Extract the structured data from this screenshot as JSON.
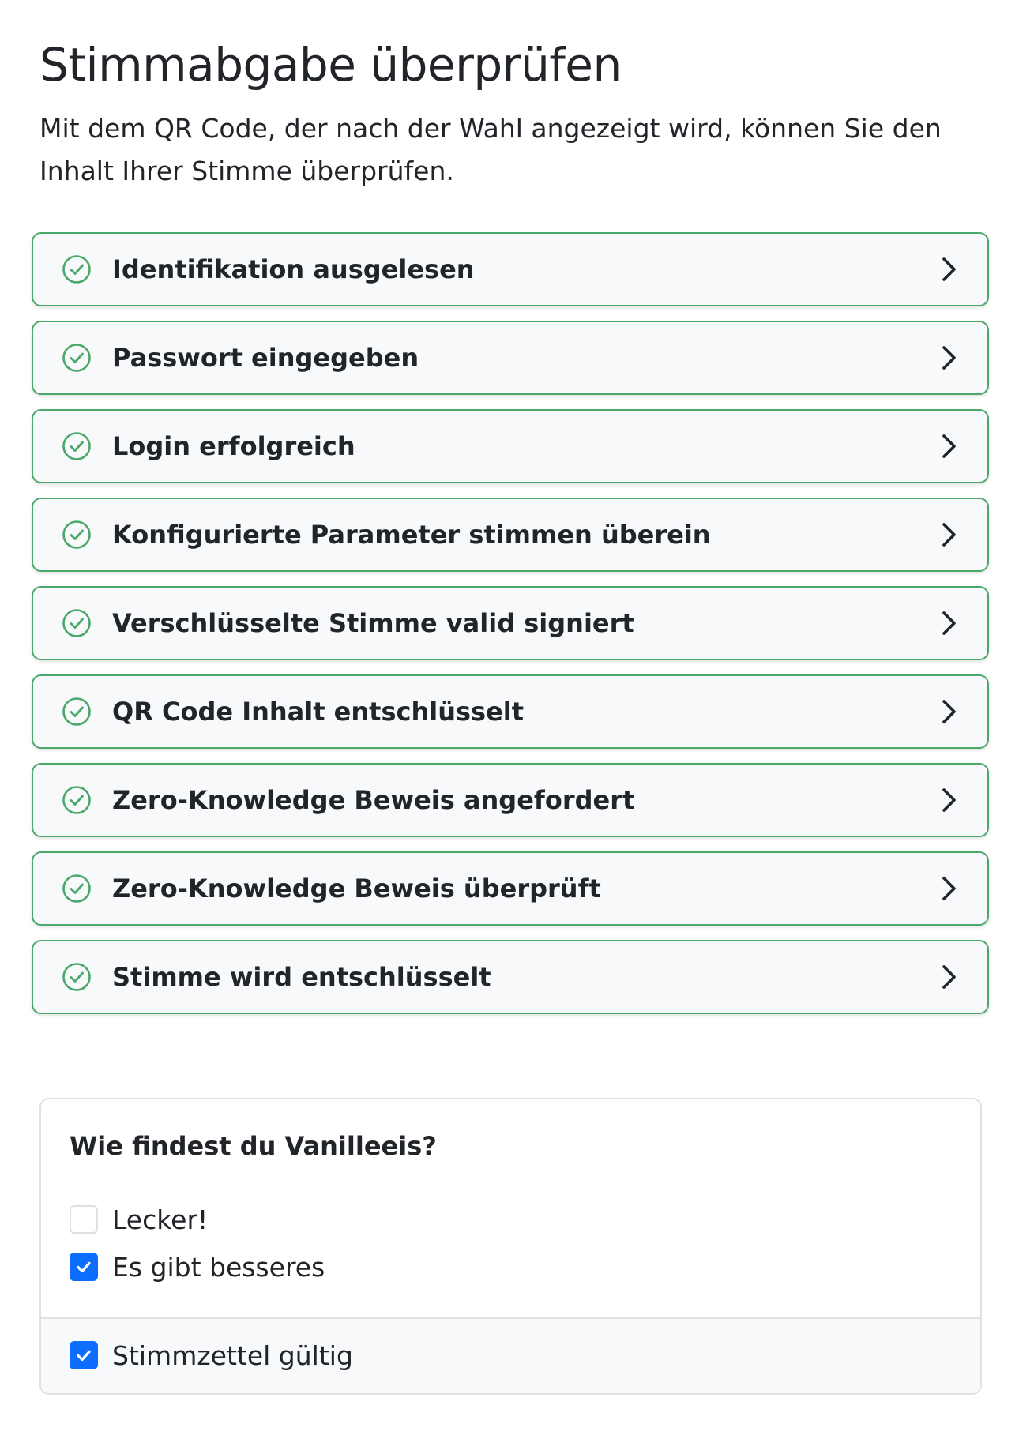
{
  "header": {
    "title": "Stimmabgabe überprüfen",
    "intro": "Mit dem QR Code, der nach der Wahl angezeigt wird, können Sie den Inhalt Ihrer Stimme überprüfen."
  },
  "steps": [
    {
      "label": "Identifikation ausgelesen",
      "status": "success"
    },
    {
      "label": "Passwort eingegeben",
      "status": "success"
    },
    {
      "label": "Login erfolgreich",
      "status": "success"
    },
    {
      "label": "Konfigurierte Parameter stimmen überein",
      "status": "success"
    },
    {
      "label": "Verschlüsselte Stimme valid signiert",
      "status": "success"
    },
    {
      "label": "QR Code Inhalt entschlüsselt",
      "status": "success"
    },
    {
      "label": "Zero-Knowledge Beweis angefordert",
      "status": "success"
    },
    {
      "label": "Zero-Knowledge Beweis überprüft",
      "status": "success"
    },
    {
      "label": "Stimme wird entschlüsselt",
      "status": "success"
    }
  ],
  "ballot": {
    "question": "Wie findest du Vanilleeis?",
    "options": [
      {
        "label": "Lecker!",
        "checked": false
      },
      {
        "label": "Es gibt besseres",
        "checked": true
      }
    ],
    "validity": {
      "label": "Stimmzettel gültig",
      "checked": true
    }
  },
  "colors": {
    "success": "#4aa86a",
    "checkbox_checked": "#0d6efd",
    "text": "#212529"
  },
  "icons": {
    "step_status": "check-circle-icon",
    "step_expand": "chevron-right-icon",
    "checkbox_mark": "check-icon"
  }
}
